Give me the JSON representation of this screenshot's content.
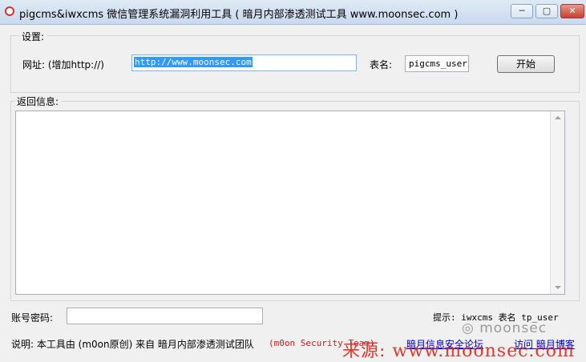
{
  "window": {
    "title": "pigcms&iwxcms 微信管理系统漏洞利用工具 ( 暗月内部渗透测试工具 www.moonsec.com )",
    "minimize_glyph": "─",
    "maximize_glyph": "▢",
    "close_glyph": "✕"
  },
  "settings": {
    "group_label": "设置:",
    "url_label": "网址: (增加http://)",
    "url_value": "http://www.moonsec.com",
    "table_label": "表名:",
    "table_value": "pigcms_user",
    "start_button": "开始"
  },
  "result": {
    "label": "返回信息:"
  },
  "account": {
    "label": "账号密码:",
    "value": ""
  },
  "hint": {
    "text": "提示: iwxcms 表名 tp_user"
  },
  "footer": {
    "description": "说明: 本工具由 (m0on原创) 来自 暗月内部渗透测试团队",
    "team": "(m0on Security Team)",
    "forum_link": "暗月信息安全论坛",
    "blog_link": "访问 暗月博客"
  },
  "watermark": {
    "logo": "moonsec",
    "source": "来源: www.moonsec.com"
  }
}
